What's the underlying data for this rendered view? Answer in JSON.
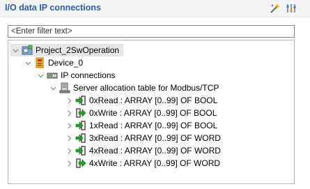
{
  "view": {
    "title": "I/O data IP connections"
  },
  "toolbar": {
    "icons": [
      "wand-icon",
      "settings-adjust-icon"
    ]
  },
  "filter": {
    "placeholder": "<Enter filter text>"
  },
  "tree": {
    "project": "Project_2SwOperation",
    "device": "Device_0",
    "ip_connections": "IP connections",
    "server_table": "Server allocation table for Modbus/TCP",
    "items": [
      {
        "label": "0xRead : ARRAY [0..99] OF BOOL",
        "dir": "read"
      },
      {
        "label": "0xWrite : ARRAY [0..99] OF BOOL",
        "dir": "write"
      },
      {
        "label": "1xRead : ARRAY [0..99] OF BOOL",
        "dir": "read"
      },
      {
        "label": "3xRead : ARRAY [0..99] OF WORD",
        "dir": "read"
      },
      {
        "label": "4xRead : ARRAY [0..99] OF WORD",
        "dir": "read"
      },
      {
        "label": "4xWrite : ARRAY [0..99] OF WORD",
        "dir": "write"
      }
    ]
  },
  "colors": {
    "title": "#2f5fa5",
    "selection": "#e6e6e6",
    "arrow_green": "#2e9a2e"
  }
}
